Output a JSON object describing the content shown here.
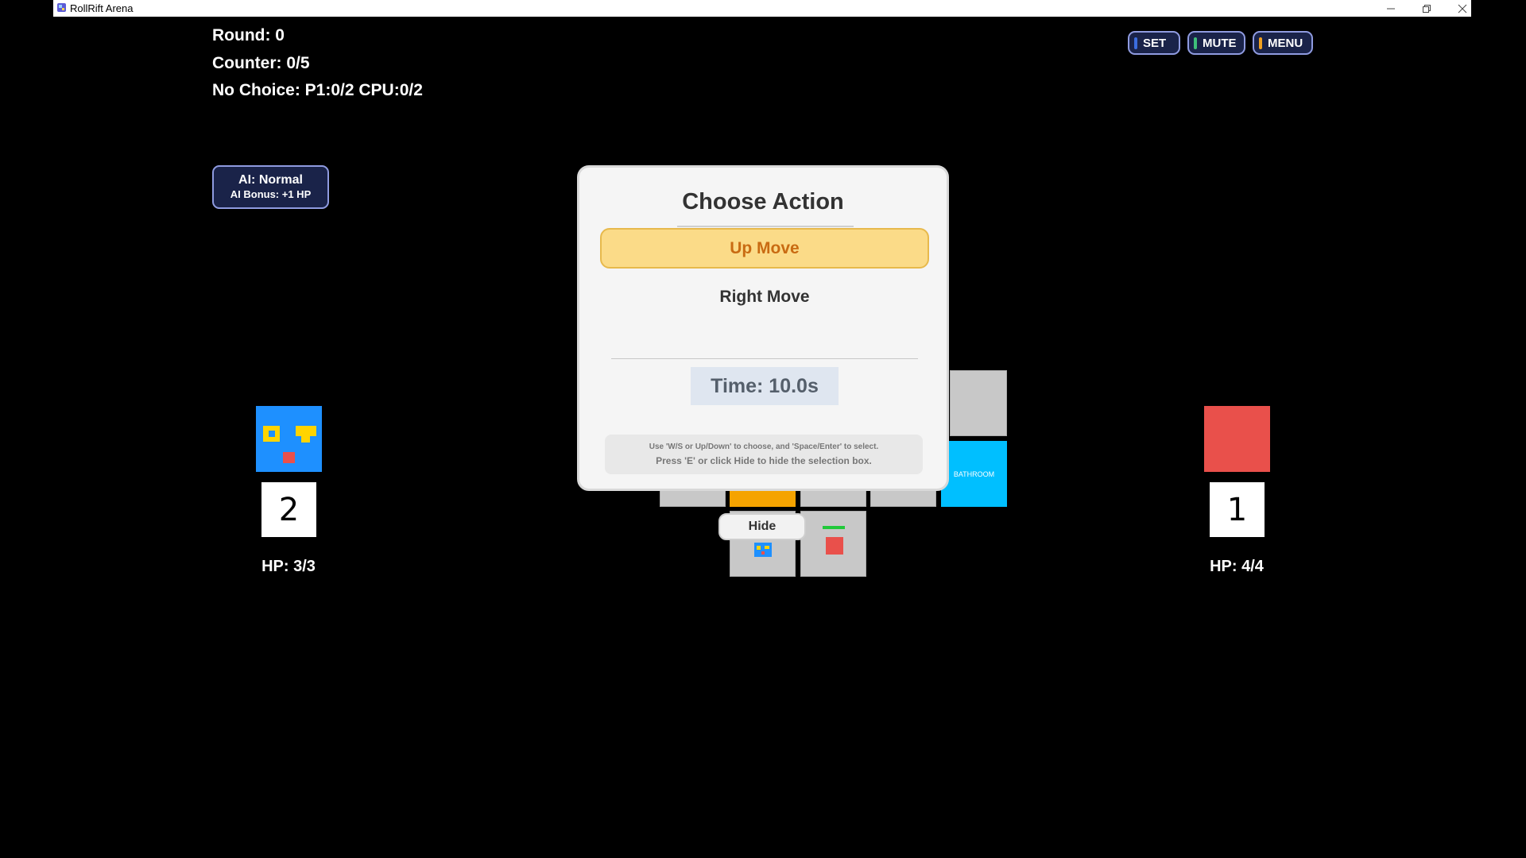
{
  "window": {
    "title": "RollRift Arena"
  },
  "hud": {
    "round": "Round: 0",
    "counter": "Counter: 0/5",
    "no_choice": "No Choice: P1:0/2 CPU:0/2"
  },
  "ai_badge": {
    "line1": "AI: Normal",
    "line2": "AI Bonus: +1 HP"
  },
  "top_buttons": {
    "set": {
      "label": "SET",
      "color": "#3b6de0"
    },
    "mute": {
      "label": "MUTE",
      "color": "#3ec07a"
    },
    "menu": {
      "label": "MENU",
      "color": "#f0a020"
    }
  },
  "player": {
    "number": "2",
    "hp": "HP: 3/3",
    "color": "#1e90ff"
  },
  "cpu": {
    "number": "1",
    "hp": "HP: 4/4",
    "color": "#e9504b"
  },
  "board": {
    "bathroom_label": "BATHROOM"
  },
  "modal": {
    "title": "Choose Action",
    "options": [
      {
        "label": "Up Move",
        "selected": true
      },
      {
        "label": "Right Move",
        "selected": false
      }
    ],
    "timer": "Time: 10.0s",
    "hint_line1": "Use 'W/S or Up/Down' to choose, and 'Space/Enter' to select.",
    "hint_line2": "Press 'E' or click Hide to hide the selection box."
  },
  "hide_button": {
    "label": "Hide"
  }
}
